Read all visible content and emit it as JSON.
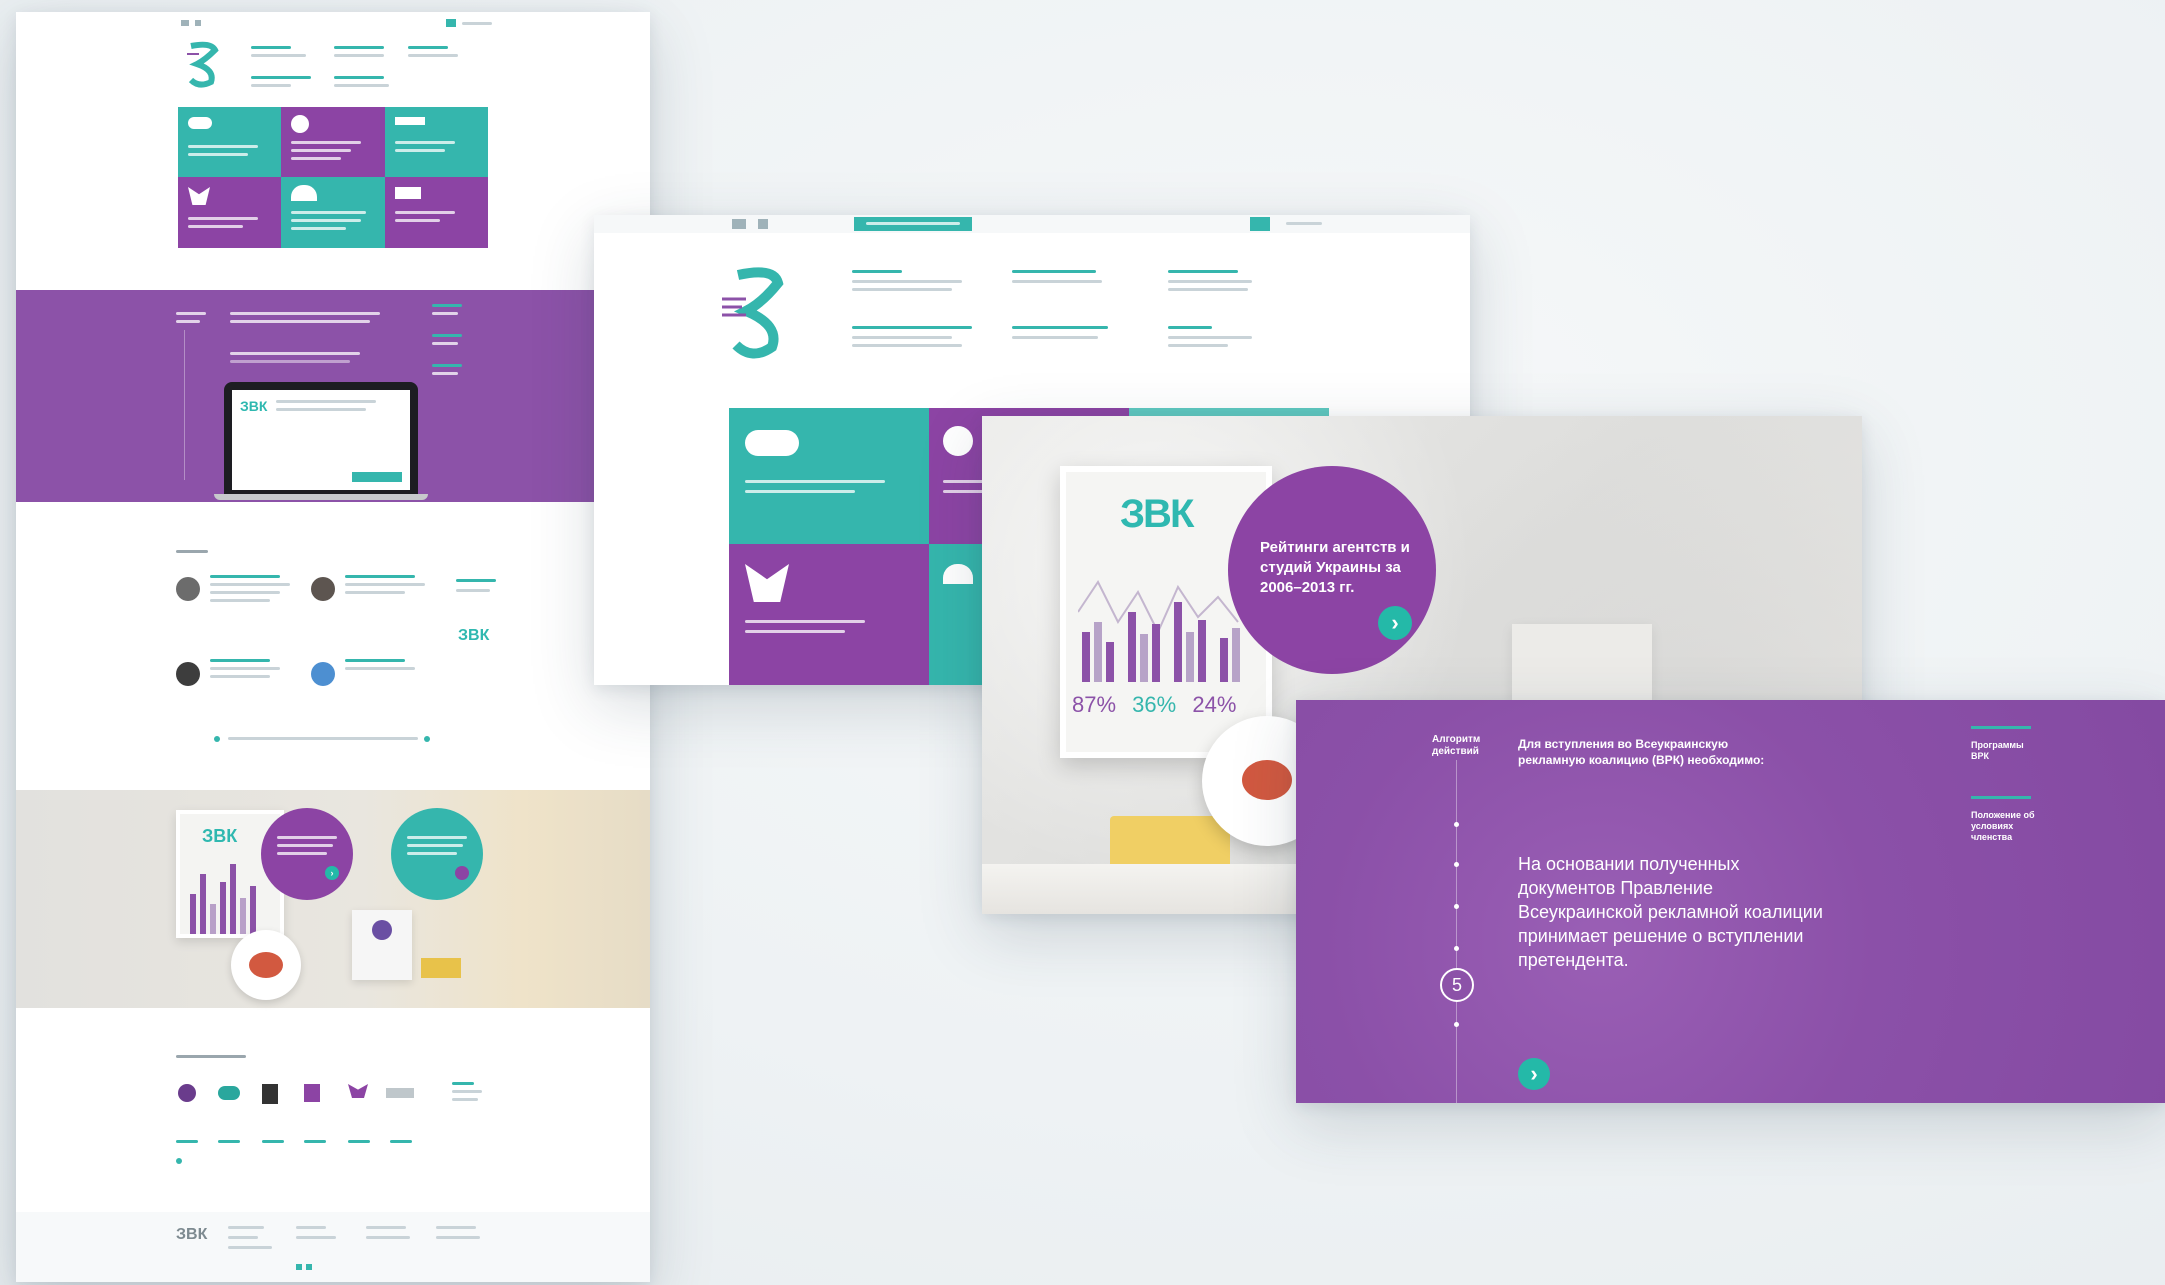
{
  "colors": {
    "teal": "#35b6ad",
    "purple": "#8c52a8",
    "button": "#24b9a8"
  },
  "overlay": {
    "ratings_title": "Рейтинги агентств и студий Украины за 2006–2013 гг.",
    "stats": [
      "87%",
      "36%",
      "24%"
    ]
  },
  "process_panel": {
    "step_label": "Алгоритм действий",
    "header": "Для вступления во Всеукраинскую рекламную коалицию (ВРК) необходимо:",
    "body": "На основании полученных документов Правление Всеукраинской рекламной коалиции принимает решение о вступлении претендента.",
    "step_number": "5",
    "side_links": [
      "Программы ВРК",
      "Положение об условиях членства"
    ]
  },
  "icons": [
    "twitter-icon",
    "facebook-icon",
    "arrow-right-icon"
  ]
}
